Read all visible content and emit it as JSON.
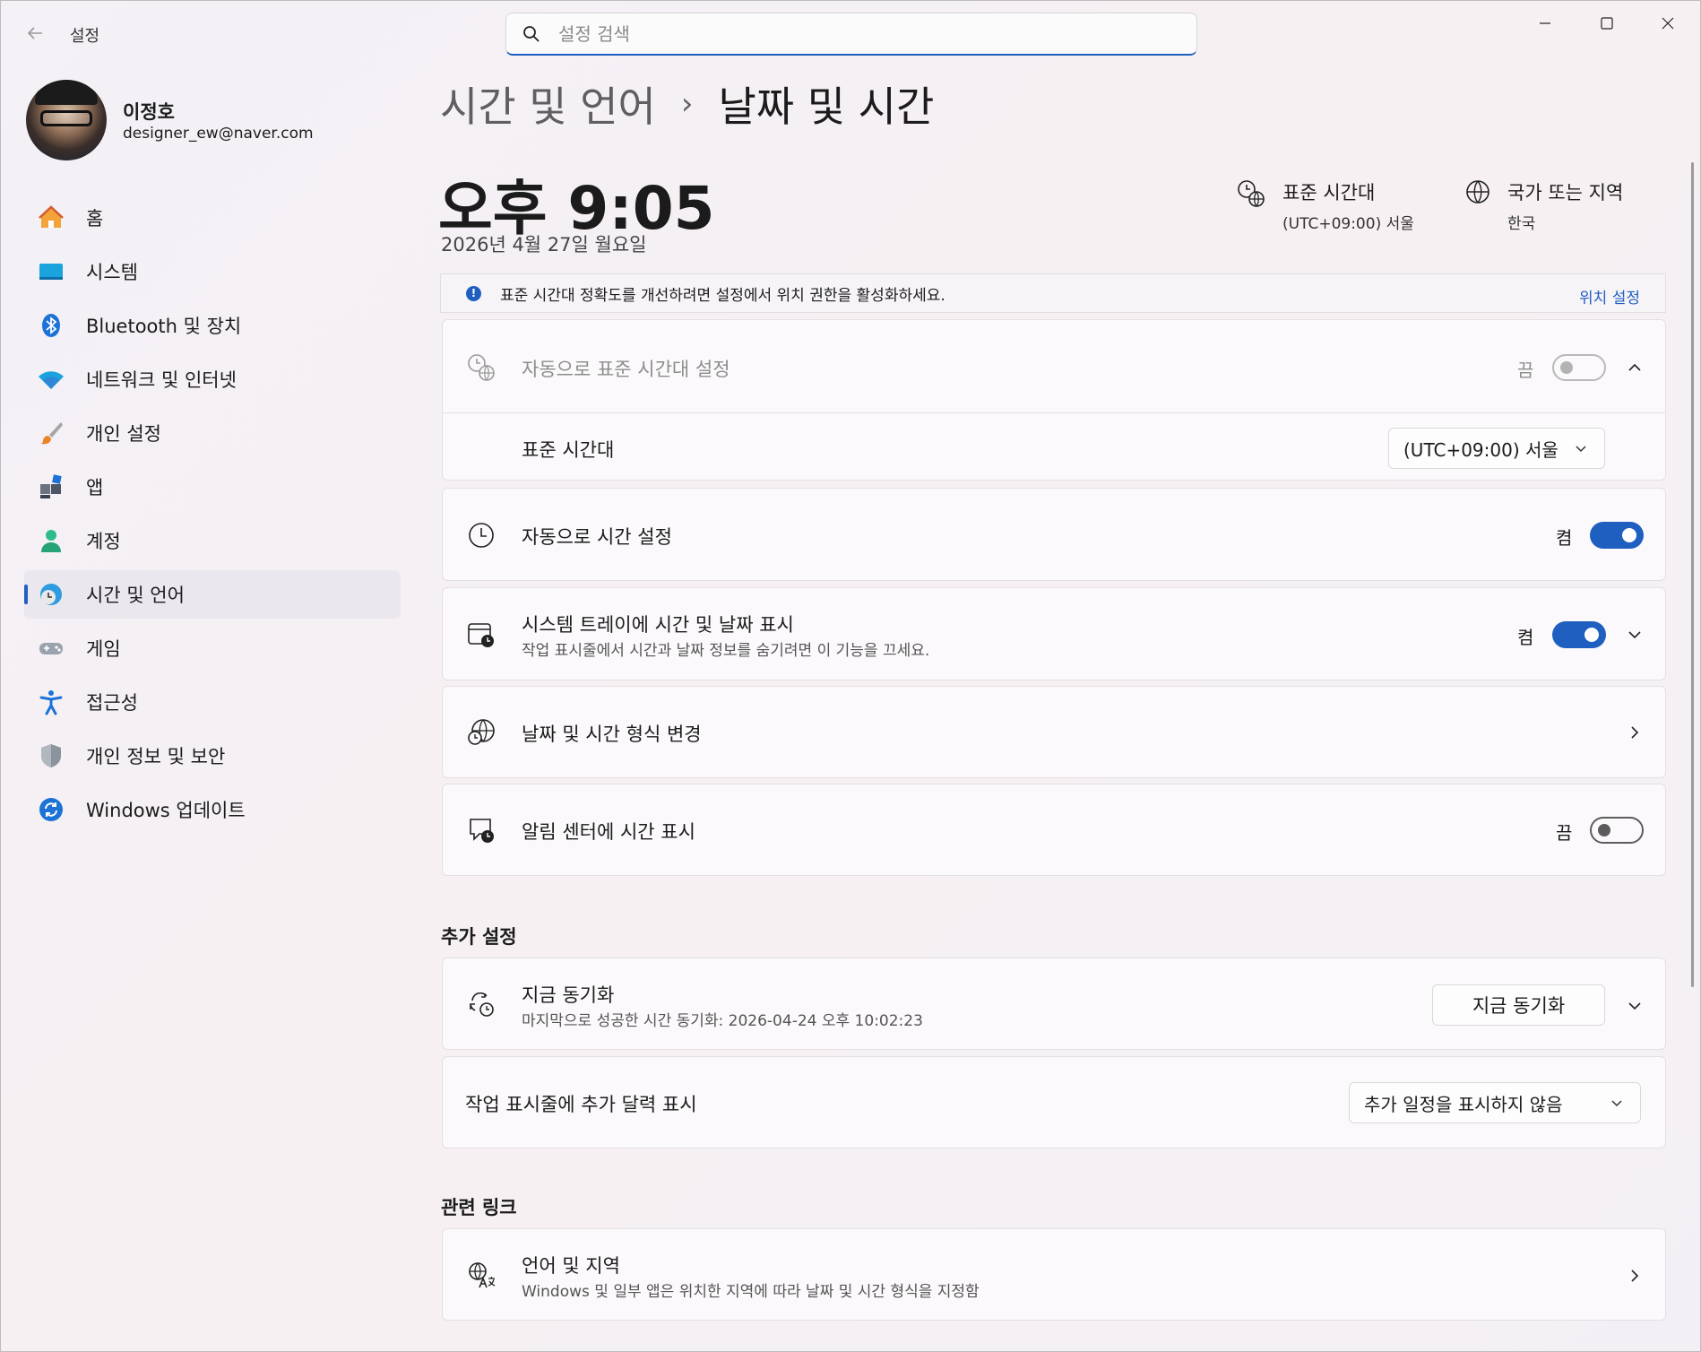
{
  "app": {
    "title": "설정"
  },
  "search": {
    "placeholder": "설정 검색"
  },
  "profile": {
    "name": "이정호",
    "email": "designer_ew@naver.com"
  },
  "sidebar": {
    "items": [
      {
        "label": "홈",
        "icon": "home-icon"
      },
      {
        "label": "시스템",
        "icon": "system-icon"
      },
      {
        "label": "Bluetooth 및 장치",
        "icon": "bluetooth-icon"
      },
      {
        "label": "네트워크 및 인터넷",
        "icon": "wifi-icon"
      },
      {
        "label": "개인 설정",
        "icon": "brush-icon"
      },
      {
        "label": "앱",
        "icon": "apps-icon"
      },
      {
        "label": "계정",
        "icon": "account-icon"
      },
      {
        "label": "시간 및 언어",
        "icon": "time-language-icon",
        "active": true
      },
      {
        "label": "게임",
        "icon": "gamepad-icon"
      },
      {
        "label": "접근성",
        "icon": "accessibility-icon"
      },
      {
        "label": "개인 정보 및 보안",
        "icon": "shield-icon"
      },
      {
        "label": "Windows 업데이트",
        "icon": "update-icon"
      }
    ]
  },
  "breadcrumb": {
    "parent": "시간 및 언어",
    "separator": "›",
    "current": "날짜 및 시간"
  },
  "clock": {
    "time": "오후 9:05",
    "date": "2026년 4월 27일 월요일"
  },
  "timezone_info": {
    "title": "표준 시간대",
    "value": "(UTC+09:00) 서울"
  },
  "region_info": {
    "title": "국가 또는 지역",
    "value": "한국"
  },
  "banner": {
    "text": "표준 시간대 정확도를 개선하려면 설정에서 위치 권한을 활성화하세요.",
    "link": "위치 설정"
  },
  "settings": {
    "auto_timezone": {
      "title": "자동으로 표준 시간대 설정",
      "state": "끔"
    },
    "timezone": {
      "title": "표준 시간대",
      "value": "(UTC+09:00) 서울"
    },
    "auto_time": {
      "title": "자동으로 시간 설정",
      "state": "켬"
    },
    "tray_time": {
      "title": "시스템 트레이에 시간 및 날짜 표시",
      "subtitle": "작업 표시줄에서 시간과 날짜 정보를 숨기려면 이 기능을 끄세요.",
      "state": "켬"
    },
    "format": {
      "title": "날짜 및 시간 형식 변경"
    },
    "notification_time": {
      "title": "알림 센터에 시간 표시",
      "state": "끔"
    }
  },
  "additional": {
    "section_title": "추가 설정",
    "sync": {
      "title": "지금 동기화",
      "subtitle": "마지막으로 성공한 시간 동기화: 2026-04-24 오후 10:02:23",
      "button": "지금 동기화"
    },
    "calendar": {
      "title": "작업 표시줄에 추가 달력 표시",
      "value": "추가 일정을 표시하지 않음"
    }
  },
  "related": {
    "section_title": "관련 링크",
    "language": {
      "title": "언어 및 지역",
      "subtitle": "Windows 및 일부 앱은 위치한 지역에 따라 날짜 및 시간 형식을 지정함"
    }
  },
  "colors": {
    "accent": "#1f5fbf"
  }
}
